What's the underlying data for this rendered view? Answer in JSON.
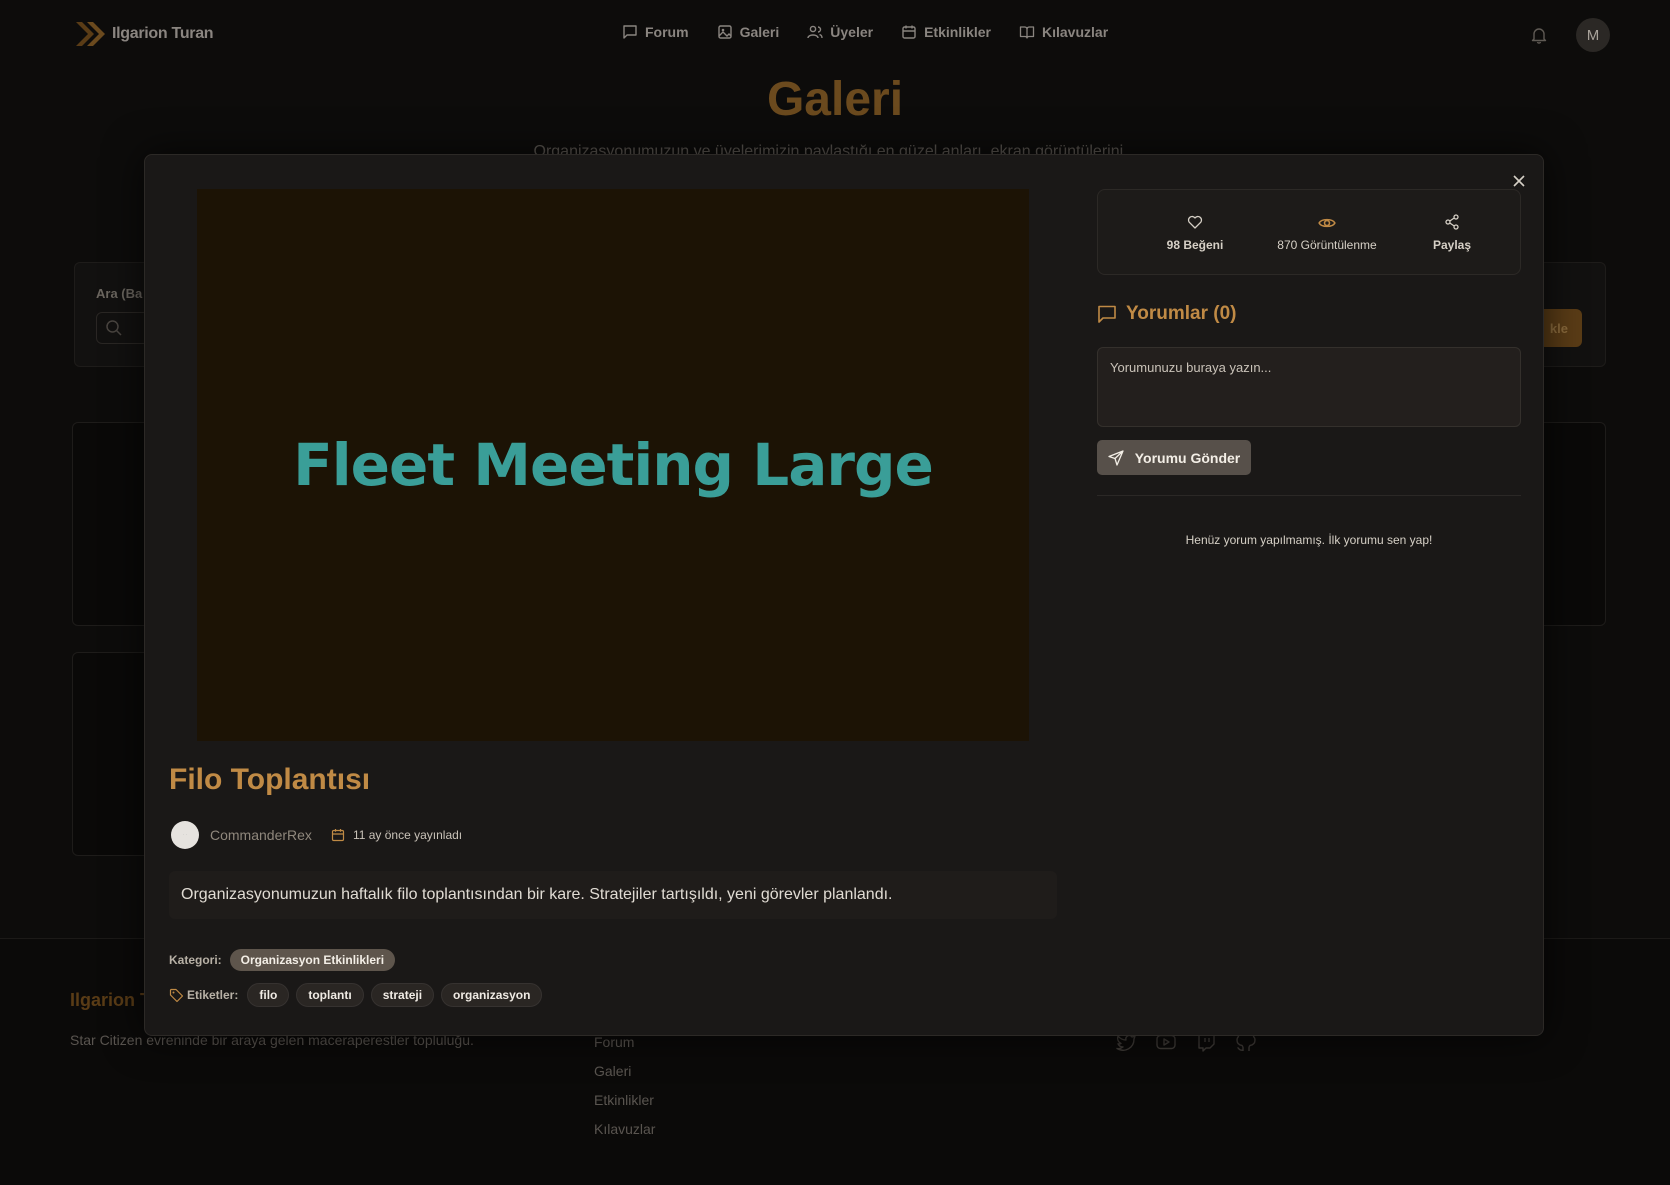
{
  "app": {
    "brand": "Ilgarion Turan",
    "avatar_initial": "M"
  },
  "nav": {
    "items": [
      {
        "label": "Forum",
        "icon": "message-square-icon"
      },
      {
        "label": "Galeri",
        "icon": "image-icon"
      },
      {
        "label": "Üyeler",
        "icon": "users-icon"
      },
      {
        "label": "Etkinlikler",
        "icon": "calendar-icon"
      },
      {
        "label": "Kılavuzlar",
        "icon": "book-icon"
      }
    ]
  },
  "page": {
    "title": "Galeri",
    "subtitle": "Organizasyonumuzun ve üyelerimizin paylaştığı en güzel anları, ekran görüntülerini...",
    "search_label": "Ara (Ba",
    "add_button_fragment": "kle"
  },
  "footer": {
    "brand": "Ilgarion T",
    "description": "Star Citizen evreninde bir araya gelen maceraperestler topluluğu.",
    "links": [
      "Forum",
      "Galeri",
      "Etkinlikler",
      "Kılavuzlar"
    ],
    "socials": [
      "twitter-icon",
      "youtube-icon",
      "twitch-icon",
      "github-icon"
    ]
  },
  "modal": {
    "image_caption": "Fleet Meeting Large",
    "title": "Filo Toplantısı",
    "author": "CommanderRex",
    "published": "11 ay önce yayınladı",
    "description": "Organizasyonumuzun haftalık filo toplantısından bir kare. Stratejiler tartışıldı, yeni görevler planlandı.",
    "category_label": "Kategori:",
    "category": "Organizasyon Etkinlikleri",
    "tags_label": "Etiketler:",
    "tags": [
      "filo",
      "toplantı",
      "strateji",
      "organizasyon"
    ],
    "stats": {
      "likes": "98 Beğeni",
      "views": "870 Görüntülenme",
      "share": "Paylaş"
    },
    "comments_title": "Yorumlar (0)",
    "comment_placeholder": "Yorumunuzu buraya yazın...",
    "send_label": "Yorumu Gönder",
    "no_comments": "Henüz yorum yapılmamış. İlk yorumu sen yap!"
  },
  "colors": {
    "accent": "#c08a45",
    "image_caption": "#3a9e98",
    "modal_bg": "#1a1817"
  }
}
